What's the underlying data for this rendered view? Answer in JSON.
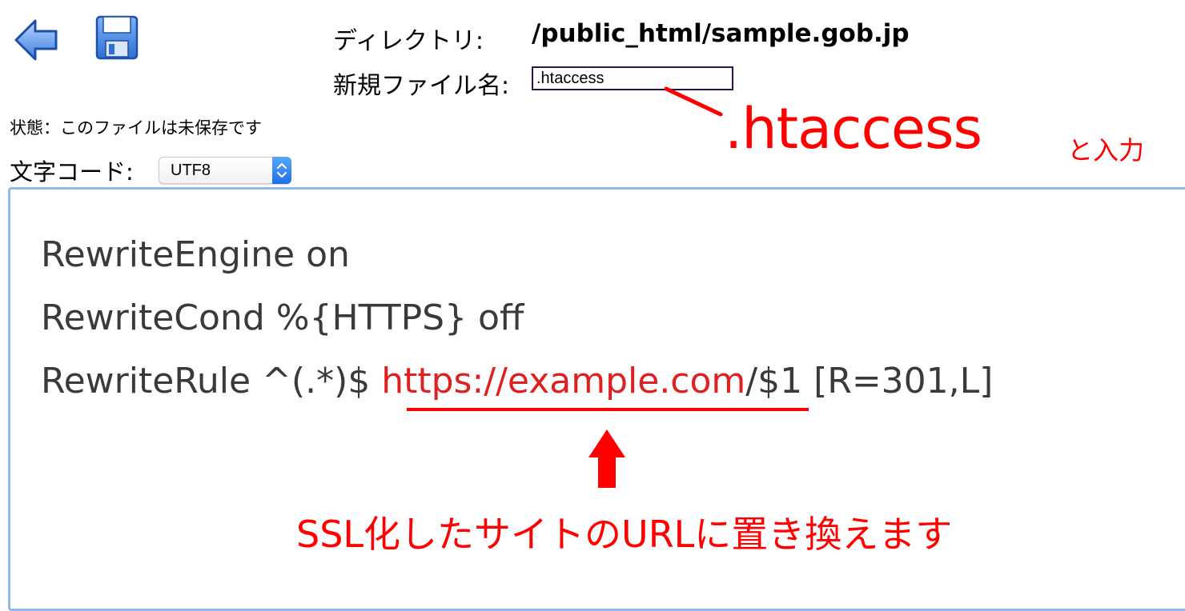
{
  "toolbar": {
    "back_icon": "back-arrow-icon",
    "save_icon": "floppy-disk-icon"
  },
  "directory": {
    "label": "ディレクトリ:",
    "value": "/public_html/sample.gob.jp"
  },
  "new_file": {
    "label": "新規ファイル名:",
    "value": ".htaccess"
  },
  "status": {
    "text": "状態：このファイルは未保存です"
  },
  "encoding": {
    "label": "文字コード:",
    "selected": "UTF8"
  },
  "editor": {
    "line1": "RewriteEngine on",
    "line2": "RewriteCond %{HTTPS} off",
    "line3_prefix": "RewriteRule ^(.*)$ ",
    "line3_url": "https://example.com",
    "line3_suffix": "/$1 [R=301,L]"
  },
  "annotations": {
    "htaccess": ".htaccess",
    "input_suffix": "と入力",
    "replace_note": "SSL化したサイトのURLに置き換えます",
    "color": "#ff0000"
  },
  "colors": {
    "editor_border": "#8fb8ee",
    "stepper_blue": "#1e6fe6",
    "input_border": "#2b1055"
  }
}
